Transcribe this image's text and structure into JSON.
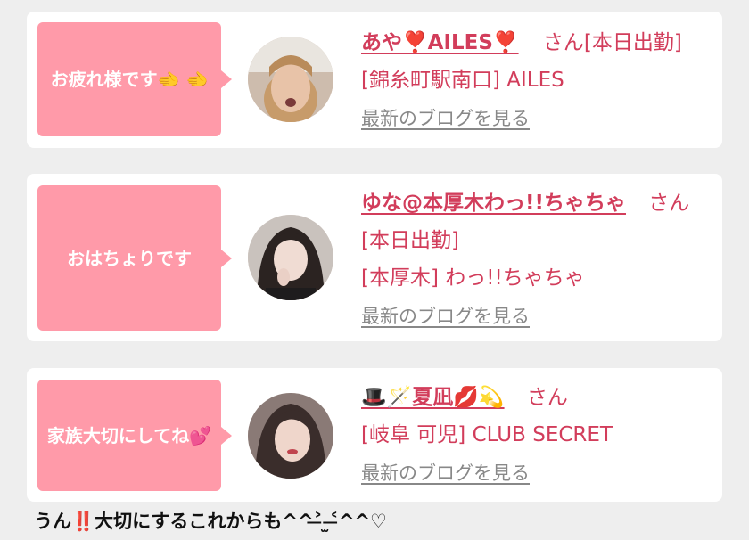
{
  "posts": [
    {
      "message": "お疲れ様です🫲 🫲",
      "name": "あや❣️AILES❣️",
      "san": "さん",
      "status": "[本日出勤]",
      "shop": "[錦糸町駅南口] AILES",
      "blog_link": "最新のブログを見る"
    },
    {
      "message": "おはちょりです",
      "name": "ゆな@本厚木わっ!!ちゃちゃ",
      "san": "さん",
      "status": "[本日出勤]",
      "shop": "[本厚木] わっ!!ちゃちゃ",
      "blog_link": "最新のブログを見る"
    },
    {
      "message": "家族大切にしてね💕",
      "name": "🎩🪄夏凪💋💫",
      "san": "さん",
      "shop": "[岐阜 可児] CLUB SECRET",
      "blog_link": "最新のブログを見る"
    }
  ],
  "footer_text": "うん‼️大切にするこれからも^^˃̶ ̫˂̶^^♡",
  "colors": {
    "accent": "#d23d5b",
    "bubble": "#ff9aa9",
    "background": "#eeeeee"
  }
}
